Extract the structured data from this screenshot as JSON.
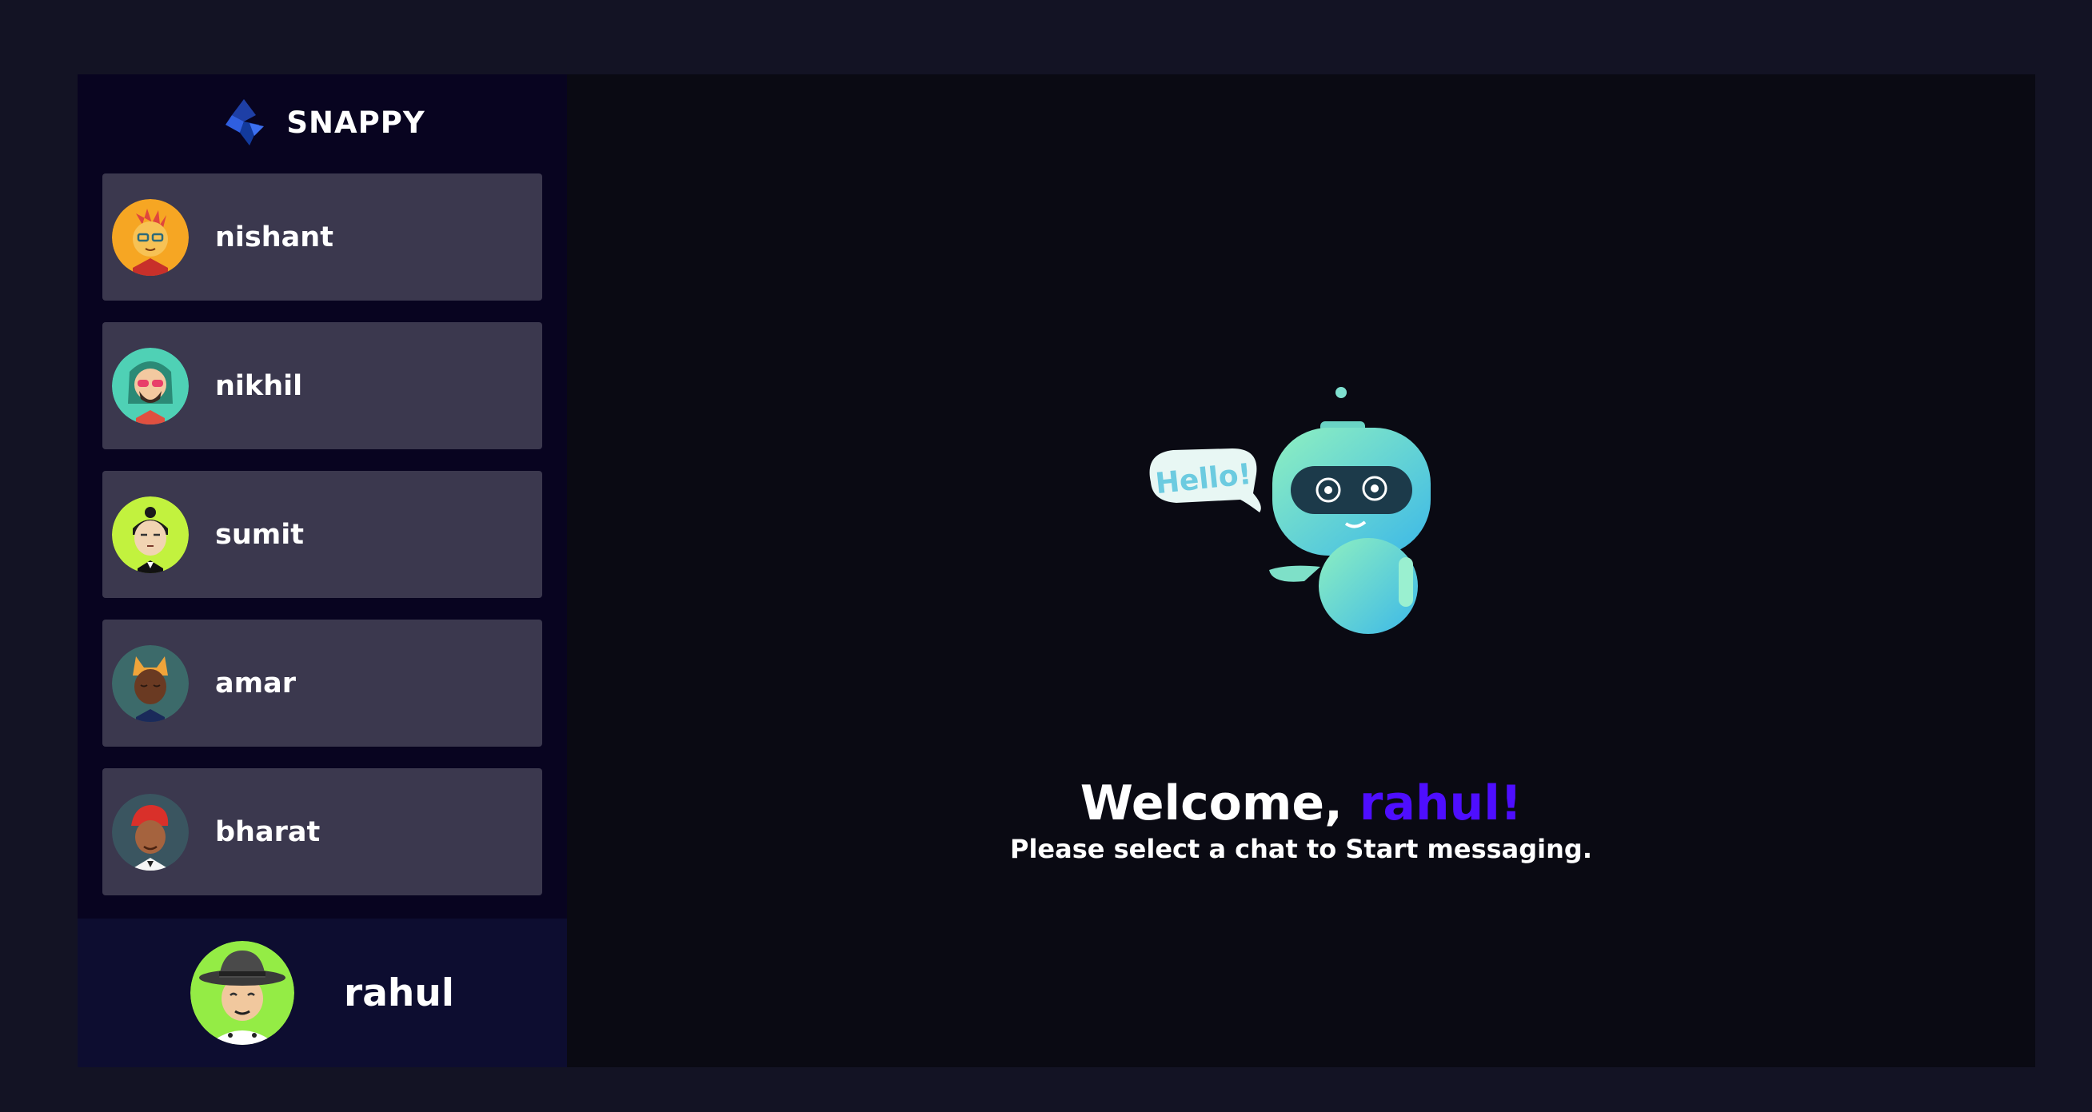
{
  "brand": {
    "name": "SNAPPY",
    "logo_icon": "snappy-diamond-logo-icon"
  },
  "contacts": [
    {
      "name": "nishant",
      "avatar_icon": "avatar-nishant-icon"
    },
    {
      "name": "nikhil",
      "avatar_icon": "avatar-nikhil-icon"
    },
    {
      "name": "sumit",
      "avatar_icon": "avatar-sumit-icon"
    },
    {
      "name": "amar",
      "avatar_icon": "avatar-amar-icon"
    },
    {
      "name": "bharat",
      "avatar_icon": "avatar-bharat-icon"
    }
  ],
  "current_user": {
    "name": "rahul",
    "avatar_icon": "avatar-rahul-icon"
  },
  "welcome": {
    "prefix": "Welcome, ",
    "username": "rahul!",
    "subtitle": "Please select a chat to Start messaging.",
    "robot_bubble": "Hello!"
  },
  "colors": {
    "page_bg": "#131324",
    "sidebar_bg": "#080420",
    "contact_bg": "#3b384e",
    "current_user_bg": "#0d0d30",
    "main_bg": "#0a0a13",
    "accent": "#4e0eff"
  }
}
